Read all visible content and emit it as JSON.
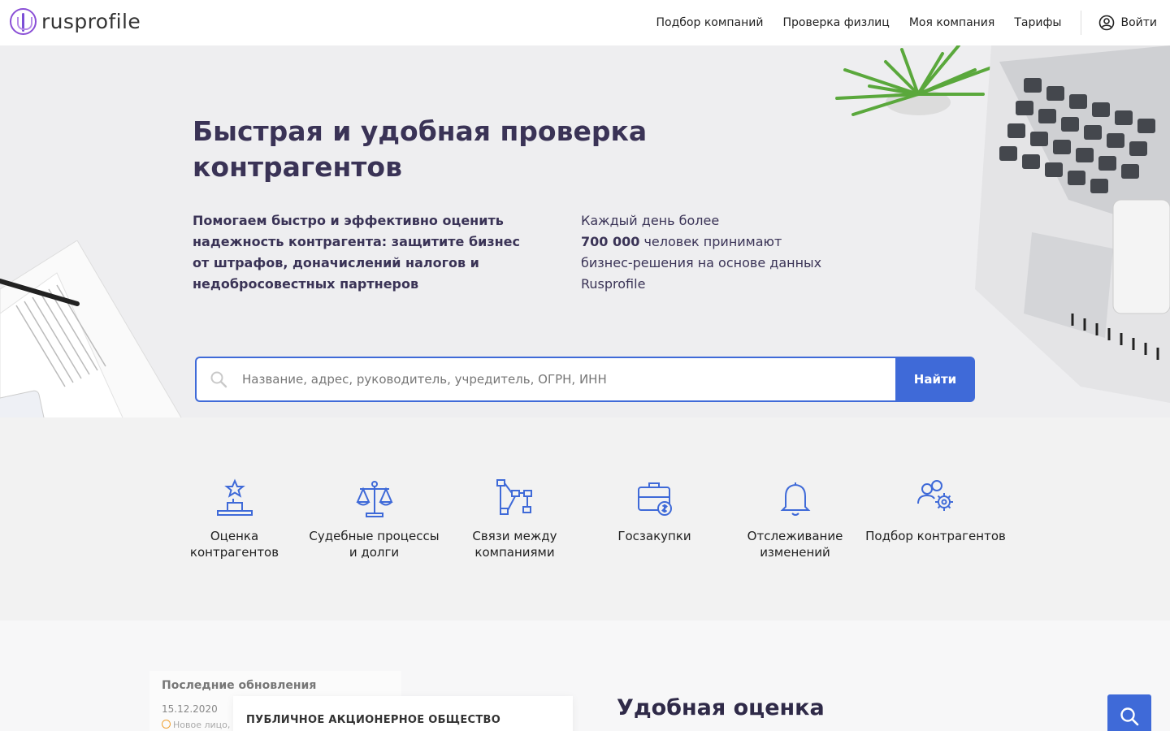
{
  "header": {
    "logo_text": "rusprofile",
    "nav": [
      "Подбор компаний",
      "Проверка физлиц",
      "Моя компания",
      "Тарифы"
    ],
    "login_label": "Войти"
  },
  "hero": {
    "title": "Быстрая и удобная проверка контрагентов",
    "left_text": "Помогаем быстро и эффективно оценить надежность контрагента: защитите бизнес от штрафов, доначислений налогов и недобросовестных партнеров",
    "right_text_1": "Каждый день более",
    "right_number": "700 000",
    "right_text_2": " человек принимают бизнес-решения на основе данных Rusprofile"
  },
  "search": {
    "placeholder": "Название, адрес, руководитель, учредитель, ОГРН, ИНН",
    "button_label": "Найти"
  },
  "features": [
    {
      "label": "Оценка контрагентов",
      "icon": "podium-star-icon"
    },
    {
      "label": "Судебные процессы и долги",
      "icon": "scales-icon"
    },
    {
      "label": "Связи между компаниями",
      "icon": "network-icon"
    },
    {
      "label": "Госзакупки",
      "icon": "briefcase-dollar-icon"
    },
    {
      "label": "Отслеживание изменений",
      "icon": "bell-icon"
    },
    {
      "label": "Подбор контрагентов",
      "icon": "people-gear-icon"
    }
  ],
  "updates": {
    "title": "Последние обновления",
    "date": "15.12.2020",
    "new_label": "Новое лицо,",
    "company_card": "ПУБЛИЧНОЕ АКЦИОНЕРНОЕ ОБЩЕСТВО"
  },
  "section_title": "Удобная оценка",
  "colors": {
    "accent": "#3f6ad8",
    "title": "#3a3356",
    "brand": "#8a4fd6"
  }
}
